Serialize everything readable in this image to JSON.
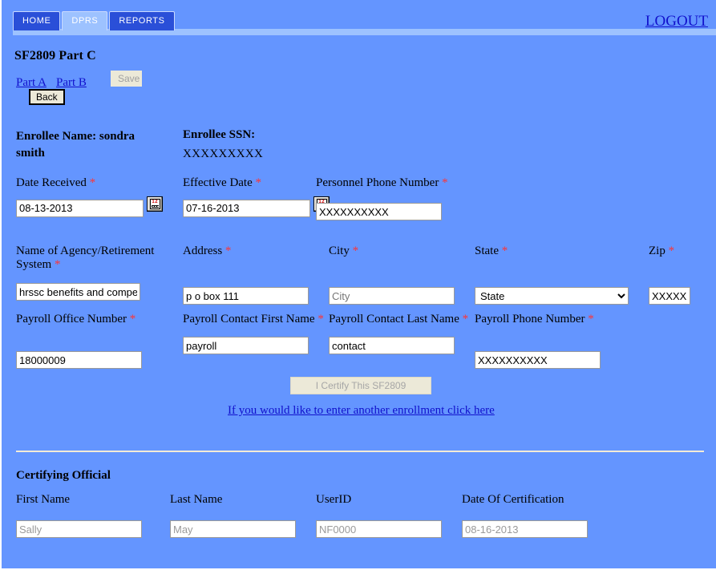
{
  "nav": {
    "tabs": [
      {
        "label": "HOME",
        "active": false
      },
      {
        "label": "DPRS",
        "active": true
      },
      {
        "label": "REPORTS",
        "active": false
      }
    ],
    "logout_label": "LOGOUT"
  },
  "page": {
    "title": "SF2809 Part C",
    "part_a_label": "Part A",
    "part_b_label": "Part B",
    "save_label": "Save",
    "back_label": "Back"
  },
  "enrollee": {
    "name_label": "Enrollee Name: sondra smith",
    "ssn_label": "Enrollee SSN:",
    "ssn_value": "XXXXXXXXX"
  },
  "form": {
    "required_marker": "*",
    "date_received": {
      "label": "Date Received",
      "value": "08-13-2013",
      "calendar_icon": "calendar-icon",
      "calendar_icon_text": "12"
    },
    "effective_date": {
      "label": "Effective Date",
      "value": "07-16-2013",
      "calendar_icon": "calendar-icon",
      "calendar_icon_text": "12"
    },
    "personnel_phone": {
      "label": "Personnel Phone Number",
      "value": "XXXXXXXXXX"
    },
    "agency_name": {
      "label": "Name of Agency/Retirement System",
      "value": "hrssc benefits and compe"
    },
    "address": {
      "label": "Address",
      "value": "p o box 111"
    },
    "city": {
      "label": "City",
      "value": "City"
    },
    "state": {
      "label": "State",
      "value": "State",
      "options": [
        "State"
      ]
    },
    "zip": {
      "label": "Zip",
      "value": "XXXXX"
    },
    "payroll_office_number": {
      "label": "Payroll Office Number",
      "value": "18000009"
    },
    "payroll_contact_first": {
      "label": "Payroll Contact First Name",
      "value": "payroll"
    },
    "payroll_contact_last": {
      "label": "Payroll Contact Last Name",
      "value": "contact"
    },
    "payroll_phone": {
      "label": "Payroll Phone Number",
      "value": "XXXXXXXXXX"
    },
    "certify_button_label": "I Certify This SF2809",
    "another_enrollment_link": "If you would like to enter another enrollment click here"
  },
  "certifying_official": {
    "section_title": "Certifying Official",
    "first_name": {
      "label": "First Name",
      "value": "Sally"
    },
    "last_name": {
      "label": "Last Name",
      "value": "May"
    },
    "user_id": {
      "label": "UserID",
      "value": "NF0000"
    },
    "date_of_certification": {
      "label": "Date Of Certification",
      "value": "08-16-2013"
    }
  },
  "colors": {
    "background": "#6495ff",
    "tab_active": "#9dc2ff",
    "tab_inactive": "#2a4fd8",
    "link": "#1111cc",
    "required": "#ff3333"
  }
}
